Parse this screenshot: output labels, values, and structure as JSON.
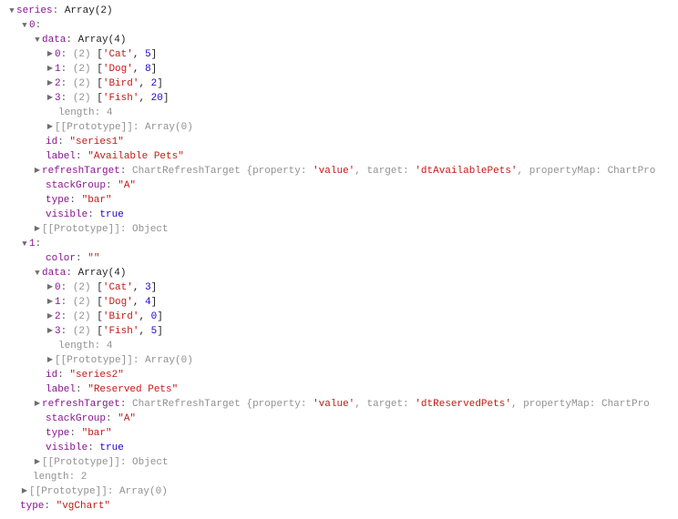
{
  "root": {
    "series_key": "series",
    "series_preview": "Array(2)",
    "length_label": "length",
    "series_length": "2",
    "proto_label": "[[Prototype]]",
    "proto_array0": "Array(0)",
    "proto_object": "Object",
    "type_key": "type",
    "type_value": "\"vgChart\""
  },
  "labels": {
    "data": "data",
    "data_preview": "Array(4)",
    "data_length": "4",
    "id": "id",
    "label": "label",
    "refreshTarget": "refreshTarget",
    "stackGroup": "stackGroup",
    "type": "type",
    "visible": "visible",
    "color": "color",
    "two_hint": "(2)"
  },
  "refresh": {
    "class": "ChartRefreshTarget",
    "property_k": "property",
    "property_v": "'value'",
    "target_k": "target",
    "pmap_k": "propertyMap",
    "pmap_prefix": "ChartPro"
  },
  "s0": {
    "idx": "0",
    "d0_k": "0",
    "d0_a": "'Cat'",
    "d0_b": "5",
    "d1_k": "1",
    "d1_a": "'Dog'",
    "d1_b": "8",
    "d2_k": "2",
    "d2_a": "'Bird'",
    "d2_b": "2",
    "d3_k": "3",
    "d3_a": "'Fish'",
    "d3_b": "20",
    "id": "\"series1\"",
    "label": "\"Available Pets\"",
    "refresh_target": "'dtAvailablePets'",
    "stackGroup": "\"A\"",
    "type": "\"bar\"",
    "visible": "true"
  },
  "s1": {
    "idx": "1",
    "color": "\"\"",
    "d0_k": "0",
    "d0_a": "'Cat'",
    "d0_b": "3",
    "d1_k": "1",
    "d1_a": "'Dog'",
    "d1_b": "4",
    "d2_k": "2",
    "d2_a": "'Bird'",
    "d2_b": "0",
    "d3_k": "3",
    "d3_a": "'Fish'",
    "d3_b": "5",
    "id": "\"series2\"",
    "label": "\"Reserved Pets\"",
    "refresh_target": "'dtReservedPets'",
    "stackGroup": "\"A\"",
    "type": "\"bar\"",
    "visible": "true"
  }
}
